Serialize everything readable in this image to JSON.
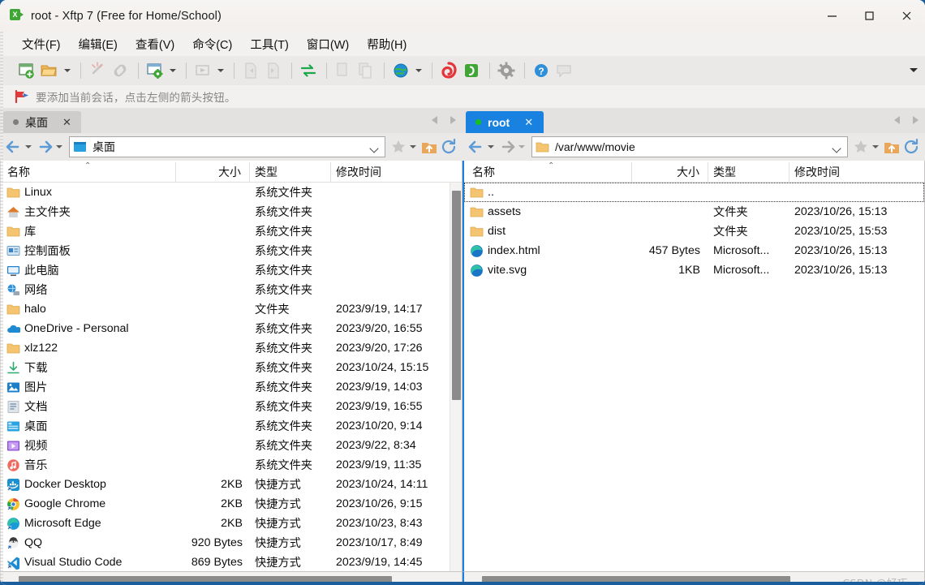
{
  "window": {
    "title": "root - Xftp 7 (Free for Home/School)",
    "app_icon": "xftp-icon",
    "minimize_label": "—",
    "maximize_label": "☐",
    "close_label": "✕"
  },
  "menubar": {
    "items": [
      {
        "label": "文件(F)",
        "name": "menu-file"
      },
      {
        "label": "编辑(E)",
        "name": "menu-edit"
      },
      {
        "label": "查看(V)",
        "name": "menu-view"
      },
      {
        "label": "命令(C)",
        "name": "menu-command"
      },
      {
        "label": "工具(T)",
        "name": "menu-tools"
      },
      {
        "label": "窗口(W)",
        "name": "menu-window"
      },
      {
        "label": "帮助(H)",
        "name": "menu-help"
      }
    ]
  },
  "toolbar": {
    "icons": [
      "new-session-icon",
      "open-folder-icon",
      "disconnect-icon",
      "link-icon",
      "session-settings-icon",
      "run-icon",
      "transfer-left-icon",
      "transfer-right-icon",
      "sync-transfer-icon",
      "copy-icon",
      "paste-icon",
      "globe-icon",
      "xshell-icon",
      "xftp-icon",
      "options-icon",
      "help-icon",
      "comment-icon"
    ],
    "overflow_label": "toolbar-overflow"
  },
  "infobar": {
    "icon": "red-flag-icon",
    "text": "要添加当前会话，点击左侧的箭头按钮。"
  },
  "panes": {
    "left": {
      "tab": {
        "label": "桌面",
        "close_label": "✕",
        "status_color": "#7d7d7d",
        "active": false
      },
      "address": {
        "value": "桌面",
        "icon": "blue-desktop-icon"
      },
      "columns": [
        "名称",
        "大小",
        "类型",
        "修改时间"
      ],
      "sort": {
        "column": "名称",
        "direction": "asc",
        "mark": "⌃"
      },
      "rows": [
        {
          "name": "Linux",
          "icon": "folder-icon",
          "size": "",
          "type": "系统文件夹",
          "modified": ""
        },
        {
          "name": "主文件夹",
          "icon": "home-icon",
          "size": "",
          "type": "系统文件夹",
          "modified": ""
        },
        {
          "name": "库",
          "icon": "folder-icon",
          "size": "",
          "type": "系统文件夹",
          "modified": ""
        },
        {
          "name": "控制面板",
          "icon": "control-panel-icon",
          "size": "",
          "type": "系统文件夹",
          "modified": ""
        },
        {
          "name": "此电脑",
          "icon": "this-pc-icon",
          "size": "",
          "type": "系统文件夹",
          "modified": ""
        },
        {
          "name": "网络",
          "icon": "network-icon",
          "size": "",
          "type": "系统文件夹",
          "modified": ""
        },
        {
          "name": "halo",
          "icon": "folder-icon",
          "size": "",
          "type": "文件夹",
          "modified": "2023/9/19, 14:17"
        },
        {
          "name": "OneDrive - Personal",
          "icon": "onedrive-icon",
          "size": "",
          "type": "系统文件夹",
          "modified": "2023/9/20, 16:55"
        },
        {
          "name": "xlz122",
          "icon": "folder-icon",
          "size": "",
          "type": "系统文件夹",
          "modified": "2023/9/20, 17:26"
        },
        {
          "name": "下载",
          "icon": "downloads-icon",
          "size": "",
          "type": "系统文件夹",
          "modified": "2023/10/24, 15:15"
        },
        {
          "name": "图片",
          "icon": "pictures-icon",
          "size": "",
          "type": "系统文件夹",
          "modified": "2023/9/19, 14:03"
        },
        {
          "name": "文档",
          "icon": "documents-icon",
          "size": "",
          "type": "系统文件夹",
          "modified": "2023/9/19, 16:55"
        },
        {
          "name": "桌面",
          "icon": "desktop-icon",
          "size": "",
          "type": "系统文件夹",
          "modified": "2023/10/20, 9:14"
        },
        {
          "name": "视频",
          "icon": "videos-icon",
          "size": "",
          "type": "系统文件夹",
          "modified": "2023/9/22, 8:34"
        },
        {
          "name": "音乐",
          "icon": "music-icon",
          "size": "",
          "type": "系统文件夹",
          "modified": "2023/9/19, 11:35"
        },
        {
          "name": "Docker Desktop",
          "icon": "docker-shortcut-icon",
          "size": "2KB",
          "type": "快捷方式",
          "modified": "2023/10/24, 14:11"
        },
        {
          "name": "Google Chrome",
          "icon": "chrome-shortcut-icon",
          "size": "2KB",
          "type": "快捷方式",
          "modified": "2023/10/26, 9:15"
        },
        {
          "name": "Microsoft Edge",
          "icon": "edge-shortcut-icon",
          "size": "2KB",
          "type": "快捷方式",
          "modified": "2023/10/23, 8:43"
        },
        {
          "name": "QQ",
          "icon": "qq-shortcut-icon",
          "size": "920 Bytes",
          "type": "快捷方式",
          "modified": "2023/10/17, 8:49"
        },
        {
          "name": "Visual Studio Code",
          "icon": "vscode-shortcut-icon",
          "size": "869 Bytes",
          "type": "快捷方式",
          "modified": "2023/9/19, 14:45"
        }
      ]
    },
    "right": {
      "tab": {
        "label": "root",
        "close_label": "✕",
        "status_color": "#18c018",
        "active": true
      },
      "address": {
        "value": "/var/www/movie",
        "icon": "folder-icon"
      },
      "columns": [
        "名称",
        "大小",
        "类型",
        "修改时间"
      ],
      "sort": {
        "column": "名称",
        "direction": "asc",
        "mark": "⌃"
      },
      "rows": [
        {
          "name": "..",
          "icon": "folder-up-icon",
          "size": "",
          "type": "",
          "modified": "",
          "focused": true
        },
        {
          "name": "assets",
          "icon": "folder-icon",
          "size": "",
          "type": "文件夹",
          "modified": "2023/10/26, 15:13"
        },
        {
          "name": "dist",
          "icon": "folder-icon",
          "size": "",
          "type": "文件夹",
          "modified": "2023/10/25, 15:53"
        },
        {
          "name": "index.html",
          "icon": "edge-file-icon",
          "size": "457 Bytes",
          "type": "Microsoft...",
          "modified": "2023/10/26, 15:13"
        },
        {
          "name": "vite.svg",
          "icon": "edge-file-icon",
          "size": "1KB",
          "type": "Microsoft...",
          "modified": "2023/10/26, 15:13"
        }
      ]
    }
  },
  "watermark": {
    "text": "CSDN @好巧."
  },
  "colors": {
    "accent": "#1982e0",
    "titlebar": "#f5f3f1",
    "toolbar": "#ebe9e7",
    "list_bg": "#ffffff",
    "folder": "#f7c55b"
  }
}
